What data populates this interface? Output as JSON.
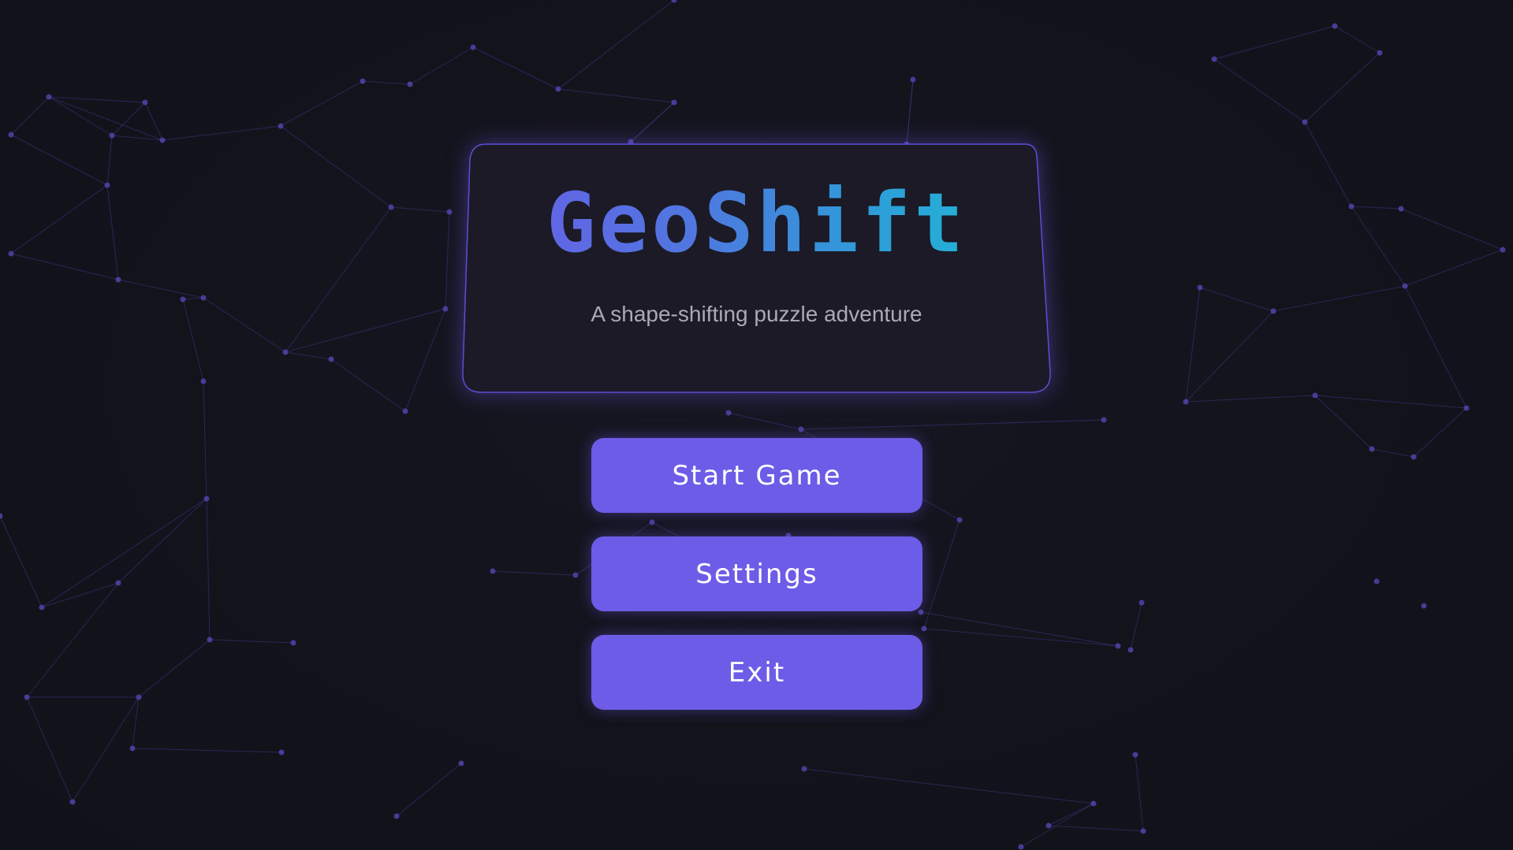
{
  "game": {
    "title": "GeoShift",
    "subtitle": "A shape-shifting puzzle adventure"
  },
  "menu": {
    "start_label": "Start Game",
    "settings_label": "Settings",
    "exit_label": "Exit"
  },
  "colors": {
    "background": "#13131d",
    "accent": "#6c5ce7",
    "title_gradient_start": "#6b5be6",
    "title_gradient_end": "#1fc0d4",
    "network_lines": "#4a3f9a"
  }
}
